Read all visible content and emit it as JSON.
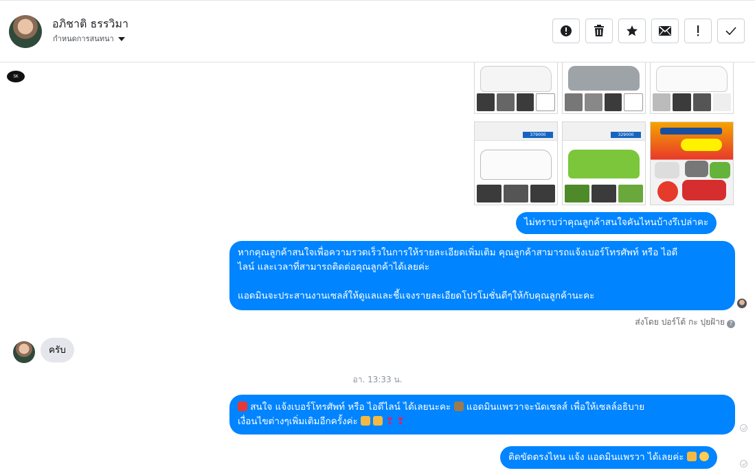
{
  "header": {
    "contact_name": "อภิชาติ ธรรวิมา",
    "subtitle": "กำหนดการสนทนา",
    "toolbar": [
      {
        "name": "report-button",
        "icon": "alert-circle-icon"
      },
      {
        "name": "delete-button",
        "icon": "trash-icon"
      },
      {
        "name": "star-button",
        "icon": "star-icon"
      },
      {
        "name": "mail-button",
        "icon": "envelope-icon"
      },
      {
        "name": "spam-button",
        "icon": "exclamation-icon"
      },
      {
        "name": "done-button",
        "icon": "checkmark-icon"
      }
    ]
  },
  "page_logo_text": "SK",
  "car_images": [
    {
      "price": "",
      "variant": "white"
    },
    {
      "price": "",
      "variant": "grey"
    },
    {
      "price": "",
      "variant": "white"
    },
    {
      "price": "379000",
      "variant": "white"
    },
    {
      "price": "329000",
      "variant": "green"
    },
    {
      "price": "",
      "variant": "promo"
    }
  ],
  "messages": {
    "m1": "ไม่ทราบว่าคุณลูกค้าสนใจคันไหนบ้างรึเปล่าคะ",
    "m2_line1": "หากคุณลูกค้าสนใจเพื่อความรวดเร็วในการให้รายละเอียดเพิ่มเติม คุณลูกค้าสามารถแจ้งเบอร์โทรศัพท์ หรือ ไอดี",
    "m2_line2": "ไลน์ และเวลาที่สามารถติดต่อคุณลูกค้าได้เลยค่ะ",
    "m2_line3": "แอดมินจะประสานงานเซลส์ให้ดูแลและชี้แจงรายละเอียดโปรโมชั่นดีๆให้กับคุณลูกค้านะคะ",
    "sent_by": "ส่งโดย ปอร์โต้ กะ ปุยฝ้าย",
    "reply": "ครับ",
    "timestamp": "อา. 13:33 น.",
    "m3_line1": "สนใจ แจ้งเบอร์โทรศัพท์ หรือ ไอดีไลน์  ได้เลยนะคะ ",
    "m3_line1b": "แอดมินแพรวาจะนัดเซลส์     เพื่อให้เซลล์อธิบาย",
    "m3_line2": "เงื่อนไขต่างๆเพิ่มเติมอีกครั้งค่ะ",
    "m4": "ติดขัดตรงไหน แจ้ง แอดมินแพรวา ได้เลยค่ะ"
  },
  "colors": {
    "bubble_out": "#0084ff",
    "bubble_in": "#e4e6eb",
    "meta": "#65676b"
  }
}
